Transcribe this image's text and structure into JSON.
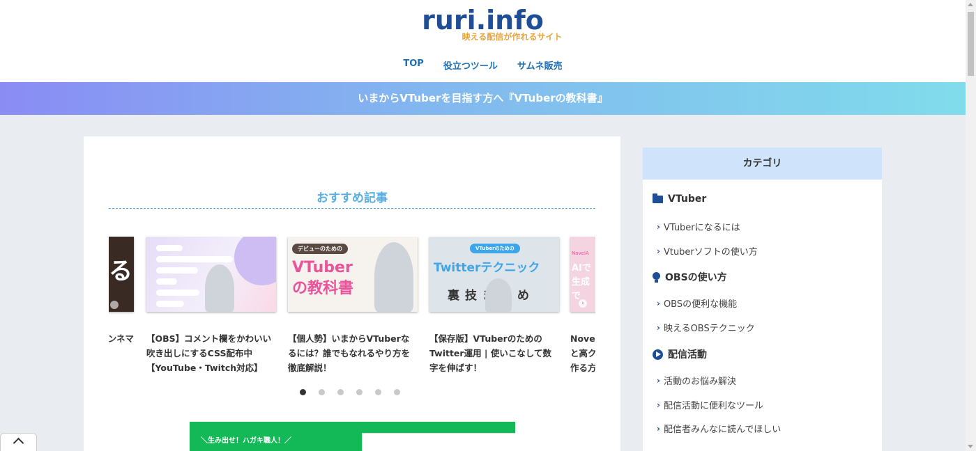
{
  "site": {
    "logo": "ruri.info",
    "tagline": "映える配信が作れるサイト"
  },
  "nav": [
    "TOP",
    "役立つツール",
    "サムネ販売"
  ],
  "banner": "いまからVTuberを目指す方へ『VTuberの教科書』",
  "main": {
    "section_title": "おすすめ記事",
    "cards": [
      {
        "title": "ンネマ",
        "thumb_text": "る"
      },
      {
        "title": "【OBS】コメント欄をかわいい吹き出しにするCSS配布中【YouTube・Twitch対応】",
        "thumb_text": ""
      },
      {
        "title": "【個人勢】いまからVTuberなるには？誰でもなれるやり方を徹底解説！",
        "thumb_text": "VTuberの教科書",
        "thumb_badge": "デビューのための"
      },
      {
        "title": "【保存版】VTuberのためのTwitter運用 | 使いこなして数字を伸ばす！",
        "thumb_text": "Twitterテクニック",
        "thumb_badge": "VTuberのための",
        "thumb_sub": "裏技まとめ"
      },
      {
        "title": "Novel と高ク 作る方",
        "thumb_text": "AIで 生成で",
        "thumb_badge": "NovelA"
      }
    ],
    "dots": 6,
    "active_dot": 0,
    "promo_text": "＼生み出せ！ハガキ職人！／"
  },
  "sidebar": {
    "heading": "カテゴリ",
    "groups": [
      {
        "label": "VTuber",
        "icon": "folder-icon",
        "items": [
          "VTuberになるには",
          "Vtuberソフトの使い方"
        ]
      },
      {
        "label": "OBSの使い方",
        "icon": "lightbulb-icon",
        "items": [
          "OBSの便利な機能",
          "映えるOBSテクニック"
        ]
      },
      {
        "label": "配信活動",
        "icon": "play-circle-icon",
        "items": [
          "活動のお悩み解決",
          "配信活動に便利なツール",
          "配信者みんなに読んでほしい"
        ]
      }
    ]
  },
  "colors": {
    "brand": "#1f4e96",
    "accent": "#5aaee3",
    "tagline": "#e8a33c",
    "nav": "#1f6fb5"
  }
}
